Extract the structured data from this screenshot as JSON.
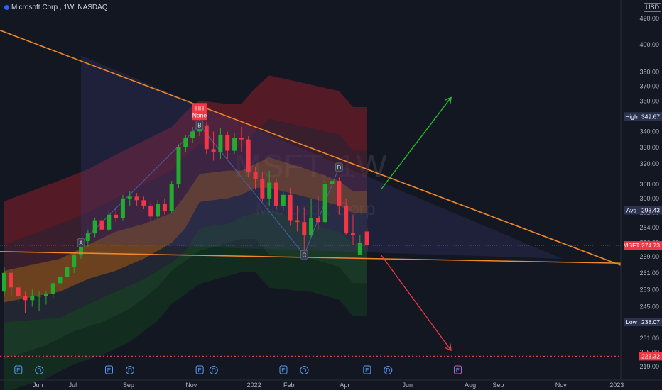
{
  "header": {
    "title": "Microsoft Corp., 1W, NASDAQ",
    "currency": "USD",
    "watermark_symbol": "MSFT, 1W",
    "watermark_name": "Microsoft Corp"
  },
  "colors": {
    "background": "#131722",
    "up": "#22ab2f",
    "down": "#f23645",
    "trendline": "#f0872a",
    "arrow_up": "#24c32f",
    "arrow_down": "#f23645",
    "high_tag": "#2a3250",
    "last_tag": "#f23645"
  },
  "price_scale": {
    "ticks": [
      420.0,
      400.0,
      380.0,
      370.0,
      360.0,
      350.0,
      340.0,
      330.0,
      320.0,
      308.0,
      300.0,
      292.0,
      284.0,
      276.0,
      269.0,
      261.0,
      253.0,
      245.0,
      238.0,
      231.0,
      225.0,
      219.0
    ],
    "tags": [
      {
        "label": "High",
        "value": "349.67",
        "price": 349.67
      },
      {
        "label": "Avg",
        "value": "293.43",
        "price": 293.43
      },
      {
        "label": "MSFT",
        "value": "274.73",
        "price": 274.73
      },
      {
        "label": "Low",
        "value": "238.07",
        "price": 238.07
      },
      {
        "label": "",
        "value": "223.32",
        "price": 223.32
      }
    ]
  },
  "time_scale": {
    "labels": [
      {
        "text": "Jun",
        "week": 4
      },
      {
        "text": "Jul",
        "week": 9
      },
      {
        "text": "Sep",
        "week": 17
      },
      {
        "text": "Nov",
        "week": 26
      },
      {
        "text": "2022",
        "week": 35
      },
      {
        "text": "Feb",
        "week": 40
      },
      {
        "text": "Apr",
        "week": 48
      },
      {
        "text": "Jun",
        "week": 57
      },
      {
        "text": "Aug",
        "week": 66
      },
      {
        "text": "Sep",
        "week": 70
      },
      {
        "text": "Nov",
        "week": 79
      },
      {
        "text": "2023",
        "week": 87
      }
    ]
  },
  "annotations": {
    "hh_label": "HH",
    "hh_sublabel": "None",
    "points": [
      {
        "label": "A",
        "week": 11,
        "price": 276
      },
      {
        "label": "B",
        "week": 28,
        "price": 344
      },
      {
        "label": "C",
        "week": 43,
        "price": 270
      },
      {
        "label": "D",
        "week": 48,
        "price": 318
      }
    ],
    "events": [
      {
        "label": "E",
        "week": 1
      },
      {
        "label": "D",
        "week": 4
      },
      {
        "label": "E",
        "week": 14
      },
      {
        "label": "D",
        "week": 17
      },
      {
        "label": "E",
        "week": 27
      },
      {
        "label": "D",
        "week": 29
      },
      {
        "label": "E",
        "week": 39
      },
      {
        "label": "D",
        "week": 42
      },
      {
        "label": "E",
        "week": 51
      },
      {
        "label": "D",
        "week": 54
      },
      {
        "label": "E",
        "week": 64
      }
    ]
  },
  "chart_data": {
    "type": "candlestick",
    "title": "Microsoft Corp., 1W, NASDAQ",
    "ylim": [
      217,
      424
    ],
    "y_scale": "log",
    "grid": false,
    "candles": [
      {
        "o": 252,
        "h": 264,
        "l": 250,
        "c": 261
      },
      {
        "o": 261,
        "h": 263,
        "l": 250,
        "c": 254
      },
      {
        "o": 254,
        "h": 258,
        "l": 247,
        "c": 250
      },
      {
        "o": 250,
        "h": 252,
        "l": 242,
        "c": 248
      },
      {
        "o": 248,
        "h": 253,
        "l": 245,
        "c": 250
      },
      {
        "o": 250,
        "h": 252,
        "l": 243,
        "c": 250
      },
      {
        "o": 250,
        "h": 252,
        "l": 246,
        "c": 251
      },
      {
        "o": 251,
        "h": 257,
        "l": 249,
        "c": 256
      },
      {
        "o": 256,
        "h": 260,
        "l": 254,
        "c": 259
      },
      {
        "o": 259,
        "h": 265,
        "l": 258,
        "c": 264
      },
      {
        "o": 264,
        "h": 271,
        "l": 261,
        "c": 270
      },
      {
        "o": 270,
        "h": 278,
        "l": 268,
        "c": 277
      },
      {
        "o": 277,
        "h": 283,
        "l": 274,
        "c": 281
      },
      {
        "o": 281,
        "h": 289,
        "l": 279,
        "c": 288
      },
      {
        "o": 288,
        "h": 290,
        "l": 282,
        "c": 283
      },
      {
        "o": 283,
        "h": 293,
        "l": 282,
        "c": 291
      },
      {
        "o": 291,
        "h": 294,
        "l": 287,
        "c": 289
      },
      {
        "o": 289,
        "h": 302,
        "l": 288,
        "c": 300
      },
      {
        "o": 300,
        "h": 304,
        "l": 296,
        "c": 301
      },
      {
        "o": 301,
        "h": 303,
        "l": 296,
        "c": 299
      },
      {
        "o": 299,
        "h": 301,
        "l": 294,
        "c": 296
      },
      {
        "o": 296,
        "h": 298,
        "l": 288,
        "c": 290
      },
      {
        "o": 290,
        "h": 299,
        "l": 289,
        "c": 297
      },
      {
        "o": 297,
        "h": 300,
        "l": 291,
        "c": 293
      },
      {
        "o": 293,
        "h": 310,
        "l": 292,
        "c": 308
      },
      {
        "o": 308,
        "h": 332,
        "l": 306,
        "c": 330
      },
      {
        "o": 330,
        "h": 338,
        "l": 327,
        "c": 336
      },
      {
        "o": 336,
        "h": 343,
        "l": 333,
        "c": 340
      },
      {
        "o": 340,
        "h": 349.67,
        "l": 337,
        "c": 344
      },
      {
        "o": 344,
        "h": 346,
        "l": 326,
        "c": 329
      },
      {
        "o": 329,
        "h": 340,
        "l": 322,
        "c": 327
      },
      {
        "o": 327,
        "h": 342,
        "l": 323,
        "c": 338
      },
      {
        "o": 338,
        "h": 340,
        "l": 323,
        "c": 328
      },
      {
        "o": 328,
        "h": 339,
        "l": 326,
        "c": 336
      },
      {
        "o": 336,
        "h": 343,
        "l": 327,
        "c": 335
      },
      {
        "o": 335,
        "h": 337,
        "l": 312,
        "c": 315
      },
      {
        "o": 315,
        "h": 318,
        "l": 305,
        "c": 311
      },
      {
        "o": 311,
        "h": 315,
        "l": 298,
        "c": 300
      },
      {
        "o": 300,
        "h": 316,
        "l": 296,
        "c": 309
      },
      {
        "o": 309,
        "h": 311,
        "l": 294,
        "c": 296
      },
      {
        "o": 296,
        "h": 304,
        "l": 293,
        "c": 302
      },
      {
        "o": 302,
        "h": 306,
        "l": 285,
        "c": 288
      },
      {
        "o": 288,
        "h": 296,
        "l": 282,
        "c": 287
      },
      {
        "o": 287,
        "h": 295,
        "l": 271,
        "c": 280
      },
      {
        "o": 280,
        "h": 300,
        "l": 279,
        "c": 289
      },
      {
        "o": 289,
        "h": 301,
        "l": 283,
        "c": 287
      },
      {
        "o": 287,
        "h": 310,
        "l": 286,
        "c": 308
      },
      {
        "o": 308,
        "h": 316,
        "l": 303,
        "c": 310
      },
      {
        "o": 310,
        "h": 312,
        "l": 291,
        "c": 296
      },
      {
        "o": 296,
        "h": 300,
        "l": 280,
        "c": 281
      },
      {
        "o": 281,
        "h": 291,
        "l": 275,
        "c": 280
      },
      {
        "o": 270,
        "h": 280,
        "l": 270,
        "c": 276
      },
      {
        "o": 282,
        "h": 284,
        "l": 272,
        "c": 274.73
      }
    ],
    "bands": {
      "outer_top": [
        [
          0,
          275
        ],
        [
          8,
          286
        ],
        [
          12,
          292
        ],
        [
          16,
          300
        ],
        [
          20,
          308
        ],
        [
          24,
          316
        ],
        [
          26,
          325
        ],
        [
          28,
          332
        ],
        [
          32,
          330
        ],
        [
          34,
          330
        ],
        [
          36,
          340
        ],
        [
          38,
          348
        ],
        [
          44,
          342
        ],
        [
          48,
          338
        ],
        [
          50,
          328
        ],
        [
          52,
          328
        ]
      ],
      "mid_top": [
        [
          0,
          262
        ],
        [
          8,
          268
        ],
        [
          12,
          275
        ],
        [
          16,
          282
        ],
        [
          20,
          286
        ],
        [
          24,
          292
        ],
        [
          26,
          302
        ],
        [
          28,
          314
        ],
        [
          32,
          316
        ],
        [
          34,
          316
        ],
        [
          36,
          320
        ],
        [
          38,
          324
        ],
        [
          44,
          316
        ],
        [
          48,
          310
        ],
        [
          50,
          304
        ],
        [
          52,
          304
        ]
      ],
      "mid_low": [
        [
          0,
          247
        ],
        [
          8,
          252
        ],
        [
          12,
          258
        ],
        [
          16,
          262
        ],
        [
          20,
          268
        ],
        [
          24,
          276
        ],
        [
          26,
          284
        ],
        [
          28,
          298
        ],
        [
          32,
          300
        ],
        [
          34,
          302
        ],
        [
          36,
          306
        ],
        [
          38,
          306
        ],
        [
          44,
          300
        ],
        [
          48,
          296
        ],
        [
          50,
          292
        ],
        [
          52,
          292
        ]
      ],
      "outer_low": [
        [
          0,
          238
        ],
        [
          8,
          240
        ],
        [
          12,
          246
        ],
        [
          16,
          252
        ],
        [
          20,
          258
        ],
        [
          24,
          266
        ],
        [
          26,
          272
        ],
        [
          28,
          284
        ],
        [
          32,
          286
        ],
        [
          34,
          290
        ],
        [
          36,
          292
        ],
        [
          38,
          294
        ],
        [
          44,
          286
        ],
        [
          48,
          282
        ],
        [
          50,
          276
        ],
        [
          52,
          276
        ]
      ],
      "bottom": [
        [
          0,
          222
        ],
        [
          6,
          228
        ],
        [
          10,
          234
        ],
        [
          14,
          238
        ],
        [
          18,
          244
        ],
        [
          22,
          254
        ],
        [
          24,
          262
        ],
        [
          28,
          272
        ],
        [
          32,
          276
        ],
        [
          34,
          278
        ],
        [
          36,
          278
        ],
        [
          38,
          270
        ],
        [
          44,
          268
        ],
        [
          48,
          264
        ],
        [
          50,
          256
        ],
        [
          52,
          256
        ]
      ]
    },
    "trendlines": [
      {
        "from": {
          "week": -7,
          "price": 424
        },
        "to": {
          "week": 100,
          "price": 250
        }
      },
      {
        "from": {
          "week": -7,
          "price": 272
        },
        "to": {
          "week": 100,
          "price": 265
        }
      }
    ],
    "projections": [
      {
        "from": {
          "week": 54,
          "price": 305
        },
        "to": {
          "week": 64,
          "price": 362
        }
      },
      {
        "from": {
          "week": 54,
          "price": 270
        },
        "to": {
          "week": 64,
          "price": 226
        }
      }
    ],
    "support_level": 223.32
  }
}
